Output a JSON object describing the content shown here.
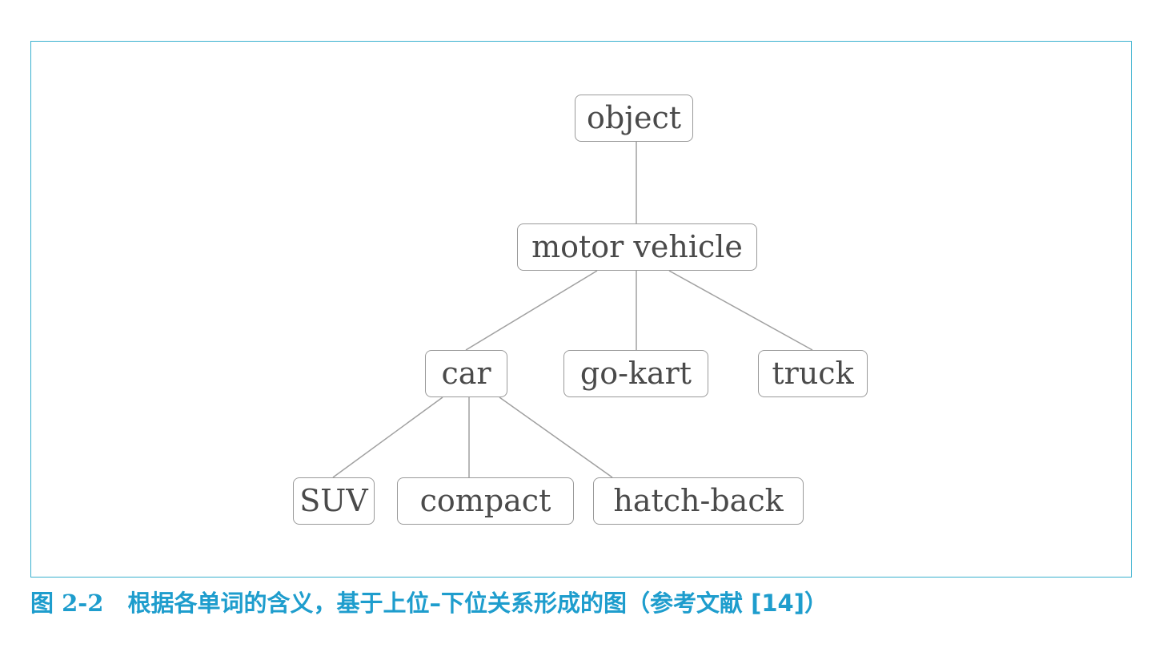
{
  "diagram": {
    "nodes": {
      "object": "object",
      "motor_vehicle": "motor vehicle",
      "car": "car",
      "go_kart": "go-kart",
      "truck": "truck",
      "suv": "SUV",
      "compact": "compact",
      "hatch_back": "hatch-back"
    },
    "edges": [
      [
        "object",
        "motor vehicle"
      ],
      [
        "motor vehicle",
        "car"
      ],
      [
        "motor vehicle",
        "go-kart"
      ],
      [
        "motor vehicle",
        "truck"
      ],
      [
        "car",
        "SUV"
      ],
      [
        "car",
        "compact"
      ],
      [
        "car",
        "hatch-back"
      ]
    ]
  },
  "caption": {
    "number": "图 2-2",
    "title": "根据各单词的含义，基于上位–下位关系形成的图（参考文献 [14]）"
  },
  "colors": {
    "frame": "#39b0cf",
    "caption": "#1e9dcd",
    "node_border": "#9a9a9a",
    "node_text": "#4a4a4a",
    "edge": "#a0a0a0"
  }
}
